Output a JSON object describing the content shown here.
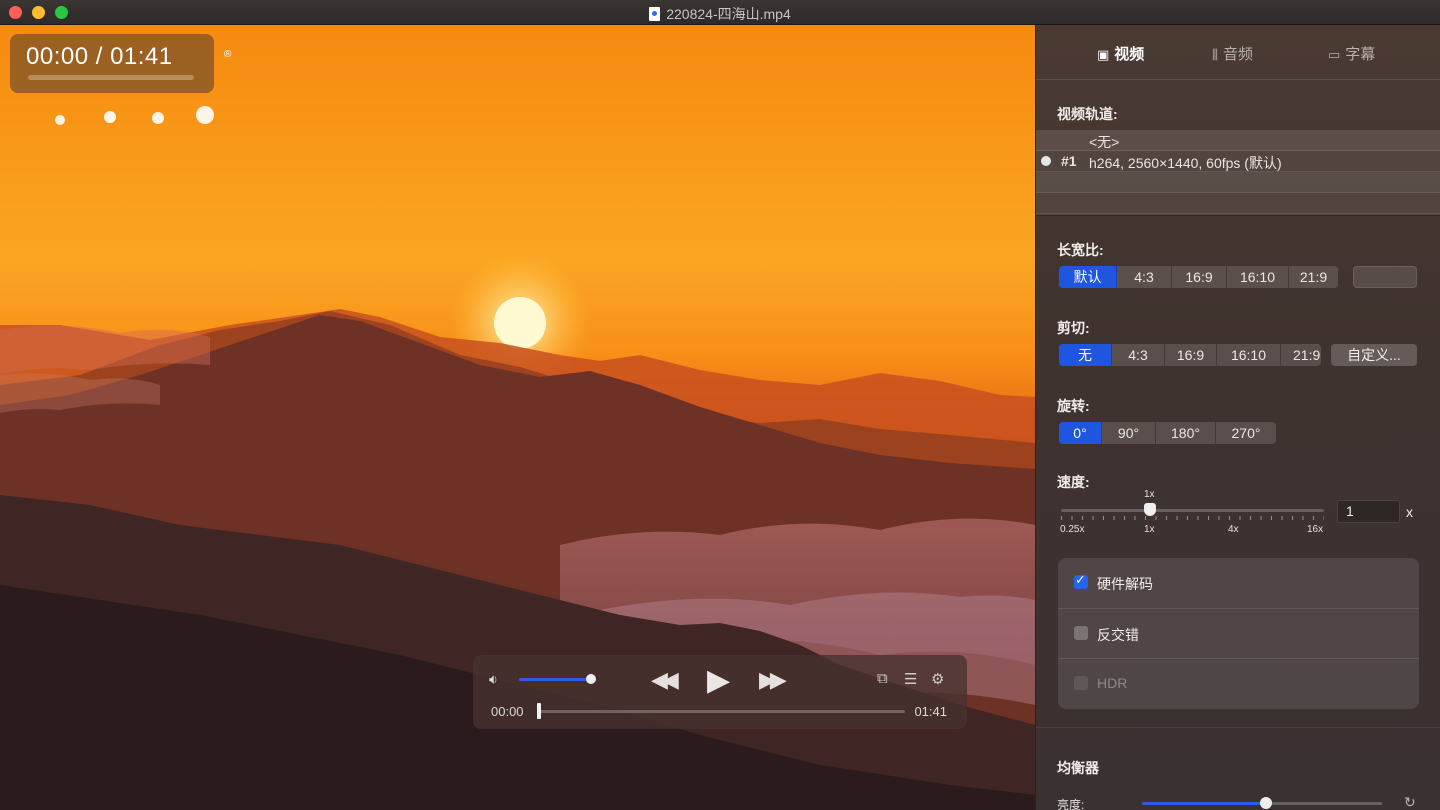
{
  "window": {
    "title": "220824-四海山.mp4"
  },
  "overlay": {
    "timecode": "00:00 / 01:41",
    "reg_mark": "®"
  },
  "controls": {
    "time_current": "00:00",
    "time_total": "01:41",
    "volume_level": 0.95,
    "progress": 0.0,
    "icons": [
      "volume-icon",
      "rewind-icon",
      "play-icon",
      "fast-forward-icon",
      "pip-icon",
      "subtitle-list-icon",
      "gear-icon"
    ]
  },
  "sidebar": {
    "tabs": [
      {
        "label": "视频",
        "icon": "image-icon",
        "active": true
      },
      {
        "label": "音频",
        "icon": "waveform-icon",
        "active": false
      },
      {
        "label": "字幕",
        "icon": "speech-bubble-icon",
        "active": false
      }
    ],
    "video_track": {
      "label": "视频轨道:",
      "none_option": "<无>",
      "tracks": [
        {
          "number": "#1",
          "description": "h264, 2560×1440, 60fps (默认)",
          "selected": true
        }
      ]
    },
    "aspect": {
      "label": "长宽比:",
      "options": [
        "默认",
        "4:3",
        "16:9",
        "16:10",
        "21:9"
      ],
      "selected": "默认",
      "custom_value": ""
    },
    "crop": {
      "label": "剪切:",
      "options": [
        "无",
        "4:3",
        "16:9",
        "16:10",
        "21:9"
      ],
      "selected": "无",
      "custom_button": "自定义..."
    },
    "rotation": {
      "label": "旋转:",
      "options": [
        "0°",
        "90°",
        "180°",
        "270°"
      ],
      "selected": "0°"
    },
    "speed": {
      "label": "速度:",
      "current_label": "1x",
      "ticks": [
        "0.25x",
        "1x",
        "4x",
        "16x"
      ],
      "value": "1",
      "unit": "x"
    },
    "options": [
      {
        "label": "硬件解码",
        "checked": true,
        "disabled": false
      },
      {
        "label": "反交错",
        "checked": false,
        "disabled": false
      },
      {
        "label": "HDR",
        "checked": false,
        "disabled": true
      }
    ],
    "equalizer": {
      "label": "均衡器",
      "brightness_label": "亮度:",
      "brightness_level": 0.52
    }
  },
  "colors": {
    "accent": "#1f56e0",
    "sidebar_bg": "#43362f",
    "sky_orange": "#f99a1a"
  }
}
